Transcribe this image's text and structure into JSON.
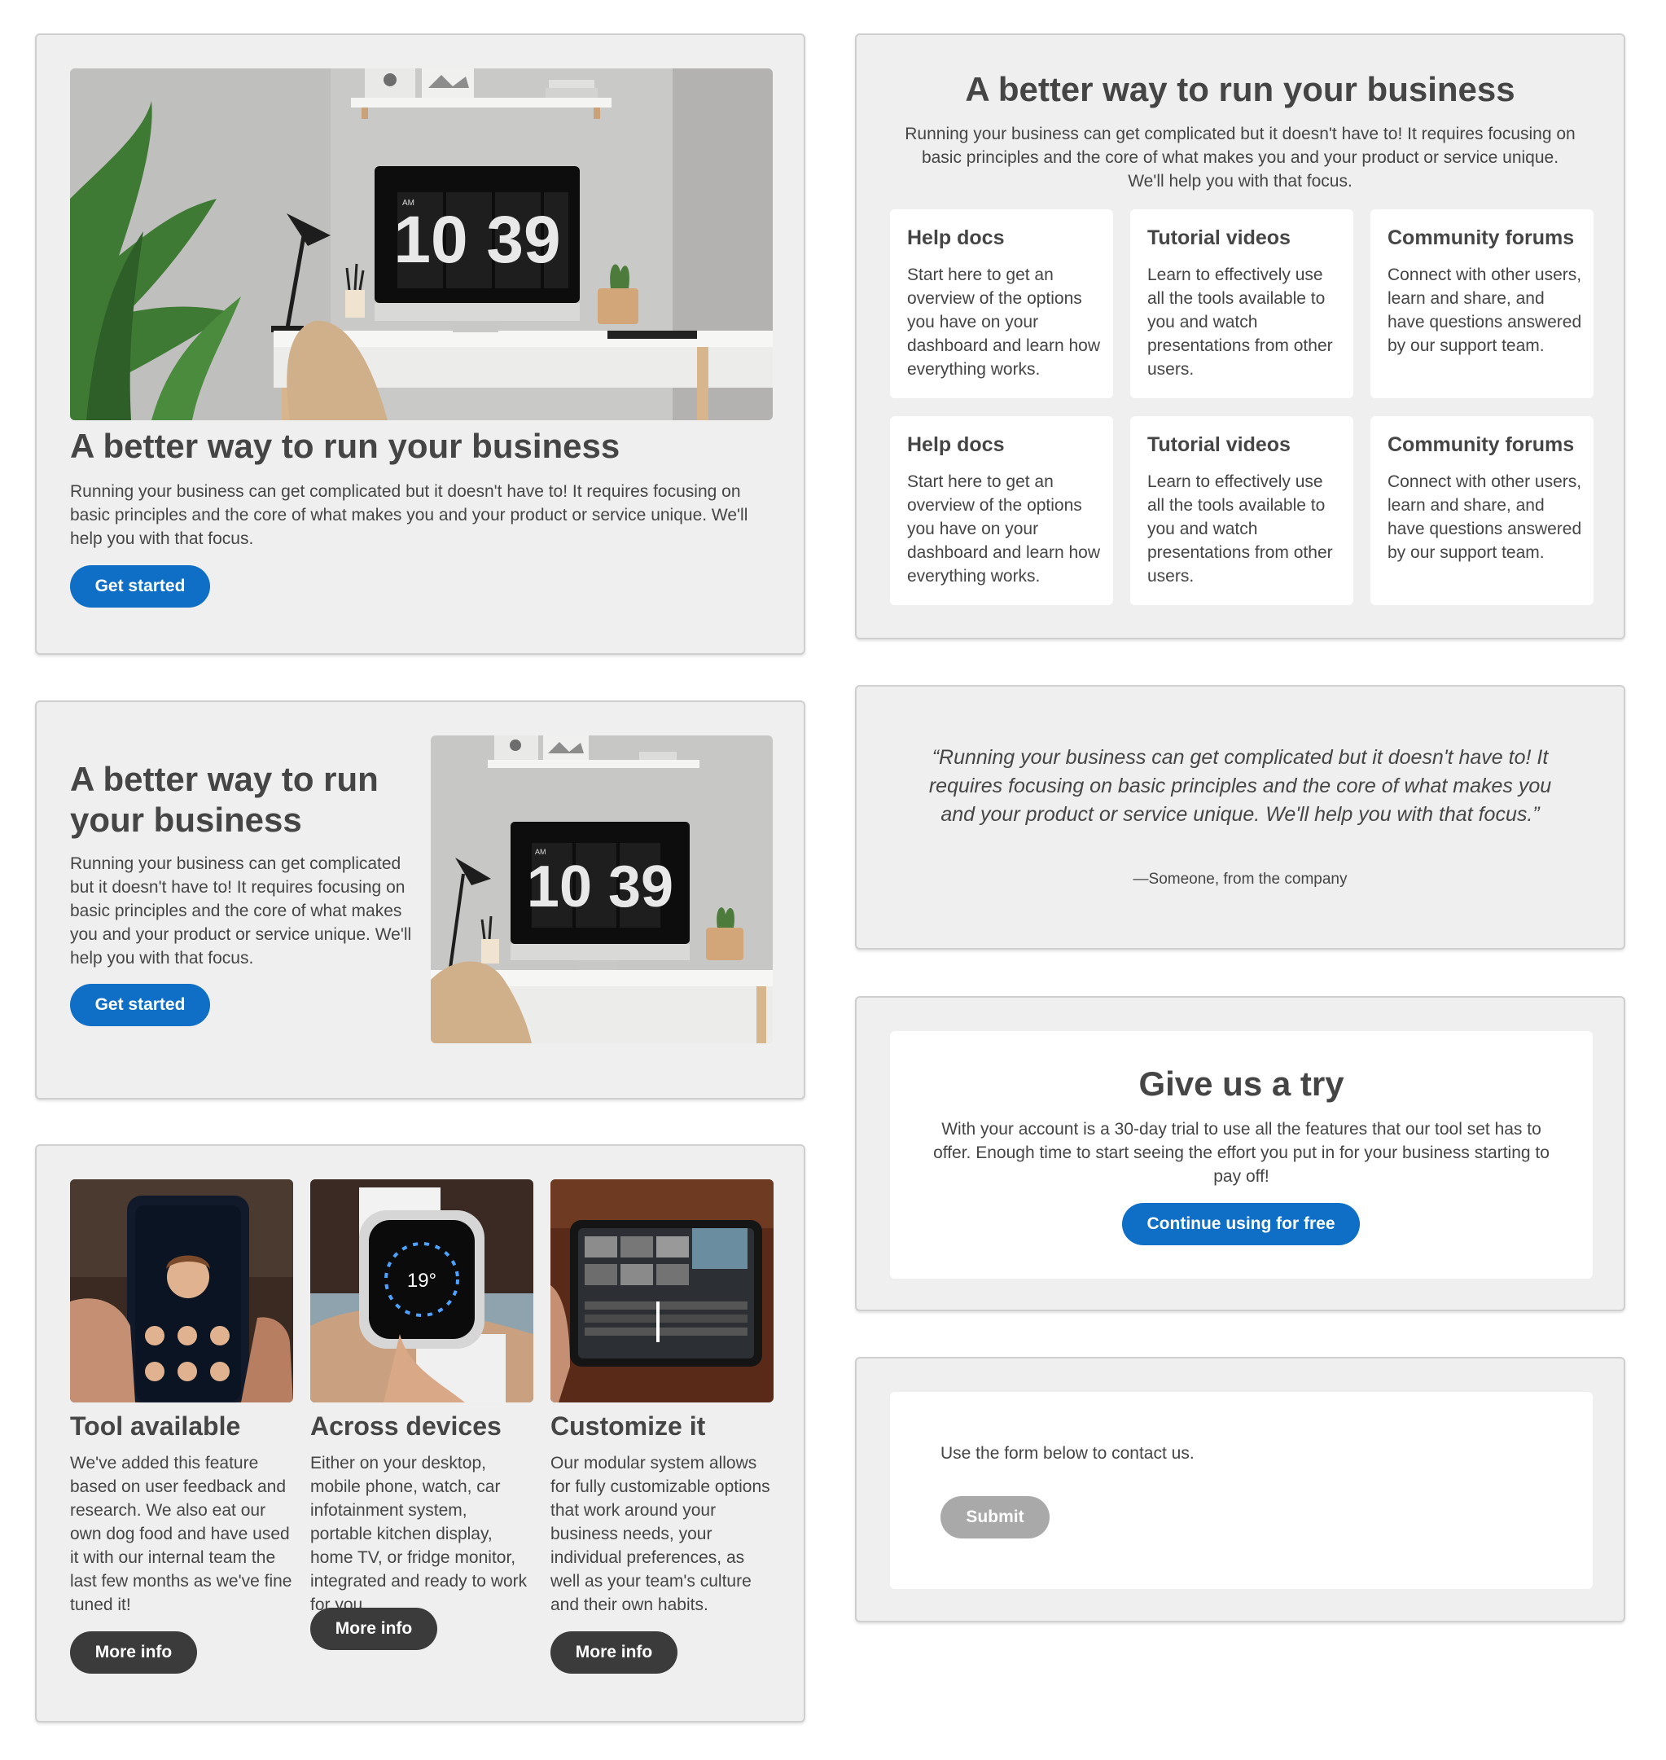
{
  "hero": {
    "title": "A better way to run your business",
    "body": "Running your business can get complicated but it doesn't have to! It requires focusing on basic principles and the core of what makes you and your product or service unique. We'll help you with that focus.",
    "cta": "Get started",
    "clock_period": "AM",
    "clock_time": "10 39"
  },
  "features": {
    "title": "A better way to run your business",
    "body": "Running your business can get complicated but it doesn't have to! It requires focusing on basic principles and the core of what makes you and your product or service unique. We'll help you with that focus.",
    "items": [
      {
        "title": "Help docs",
        "text": "Start here to get an overview of the options you have on your dashboard and learn how everything works."
      },
      {
        "title": "Tutorial videos",
        "text": "Learn to effectively use all the tools available to you and watch presentations from other users."
      },
      {
        "title": "Community forums",
        "text": "Connect with other users, learn and share, and have questions answered by our support team."
      },
      {
        "title": "Help docs",
        "text": "Start here to get an overview of the options you have on your dashboard and learn how everything works."
      },
      {
        "title": "Tutorial videos",
        "text": "Learn to effectively use all the tools available to you and watch presentations from other users."
      },
      {
        "title": "Community forums",
        "text": "Connect with other users, learn and share, and have questions answered by our support team."
      }
    ]
  },
  "split": {
    "title": "A better way to run your business",
    "body": "Running your business can get complicated but it doesn't have to! It requires focusing on basic principles and the core of what makes you and your product or service unique. We'll help you with that focus.",
    "cta": "Get started",
    "clock_period": "AM",
    "clock_time": "10 39"
  },
  "quote": {
    "text": "“Running your business can get complicated but it doesn't have to! It requires focusing on basic principles and the core of what makes you and your product or service unique. We'll help you with that focus.”",
    "author": "—Someone, from the company"
  },
  "trial": {
    "title": "Give us a try",
    "body": "With your account is a 30-day trial to use all the features that our tool set has to offer. Enough time to start seeing the effort you put in for your business starting to pay off!",
    "cta": "Continue using for free"
  },
  "contact": {
    "label": "Use the form below to contact us.",
    "submit": "Submit"
  },
  "tiles": [
    {
      "title": "Tool available",
      "text": "We've added this feature based on user feedback and research. We also eat our own dog food and have used it with our internal team the last few months as we've fine tuned it!",
      "cta": "More info"
    },
    {
      "title": "Across devices",
      "text": "Either on your desktop, mobile phone, watch, car infotainment system, portable kitchen display, home TV, or fridge monitor, integrated and ready to work for you.",
      "cta": "More info",
      "watch_temp": "19°"
    },
    {
      "title": "Customize it",
      "text": "Our modular system allows for fully customizable options that work around your business needs, your individual preferences, as well as your team's culture and their own habits.",
      "cta": "More info"
    }
  ],
  "colors": {
    "primary": "#0f6fc6",
    "dark_button": "#3b3b3b",
    "disabled_button": "#a9a9a9",
    "card_bg": "#efefef",
    "text": "#454545"
  }
}
